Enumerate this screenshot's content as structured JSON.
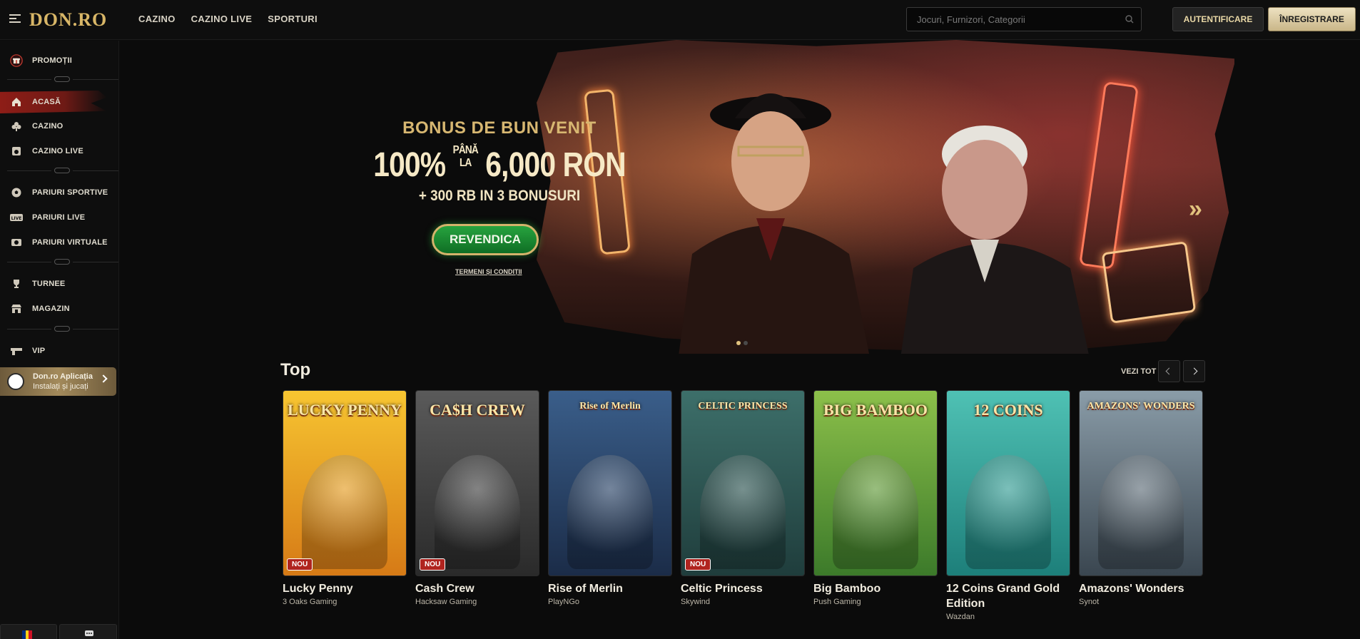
{
  "header": {
    "logo": "DON.RO",
    "nav": [
      "CAZINO",
      "CAZINO LIVE",
      "SPORTURI"
    ],
    "search_placeholder": "Jocuri, Furnizori, Categorii",
    "login_label": "AUTENTIFICARE",
    "register_label": "ÎNREGISTRARE"
  },
  "sidebar": {
    "items": [
      {
        "label": "PROMOȚII",
        "icon": "gift-icon"
      },
      {
        "label": "ACASĂ",
        "icon": "home-icon",
        "active": true
      },
      {
        "label": "CAZINO",
        "icon": "club-icon"
      },
      {
        "label": "CAZINO LIVE",
        "icon": "live-casino-icon"
      },
      {
        "label": "PARIURI SPORTIVE",
        "icon": "soccer-ball-icon"
      },
      {
        "label": "PARIURI LIVE",
        "icon": "live-badge-icon"
      },
      {
        "label": "PARIURI VIRTUALE",
        "icon": "virtual-sports-icon"
      },
      {
        "label": "TURNEE",
        "icon": "trophy-icon"
      },
      {
        "label": "MAGAZIN",
        "icon": "shop-icon"
      },
      {
        "label": "VIP",
        "icon": "vip-gun-icon"
      }
    ],
    "app_card": {
      "title": "Don.ro Aplicația",
      "subtitle": "Instalați și jucați"
    },
    "bottom": {
      "language_flag": "ro-flag-icon",
      "chat": "chat-icon"
    }
  },
  "banner": {
    "heading": "BONUS DE BUN VENIT",
    "offer_prefix": "100%",
    "offer_small_top": "PÂNĂ",
    "offer_small_bottom": "LA",
    "offer_amount": "6,000 RON",
    "offer_extra": "+ 300 RB IN 3 BONUSURI",
    "cta": "REVENDICA",
    "terms": "TERMENI ȘI CONDIȚII",
    "slide_count": 2,
    "active_slide": 1
  },
  "top_section": {
    "title": "Top",
    "see_all": "VEZI TOT",
    "games": [
      {
        "name": "Lucky Penny",
        "provider": "3 Oaks Gaming",
        "badge": "NOU",
        "art_title": "LUCKY PENNY",
        "colors": [
          "#f7c531",
          "#d67a16"
        ]
      },
      {
        "name": "Cash Crew",
        "provider": "Hacksaw Gaming",
        "badge": "NOU",
        "art_title": "CA$H CREW",
        "colors": [
          "#5a5a5a",
          "#2a2a2a"
        ]
      },
      {
        "name": "Rise of Merlin",
        "provider": "PlayNGo",
        "badge": "",
        "art_title": "Rise of Merlin",
        "colors": [
          "#3a5e8a",
          "#1b2c48"
        ]
      },
      {
        "name": "Celtic Princess",
        "provider": "Skywind",
        "badge": "NOU",
        "art_title": "CELTIC PRINCESS",
        "colors": [
          "#3d6f6a",
          "#1f3d3c"
        ]
      },
      {
        "name": "Big Bamboo",
        "provider": "Push Gaming",
        "badge": "",
        "art_title": "BIG BAMBOO",
        "colors": [
          "#8cc04a",
          "#3c7a2a"
        ]
      },
      {
        "name": "12 Coins Grand Gold Edition",
        "provider": "Wazdan",
        "badge": "",
        "art_title": "12 COINS",
        "colors": [
          "#4fc1b4",
          "#1d7f7a"
        ]
      },
      {
        "name": "Amazons' Wonders",
        "provider": "Synot",
        "badge": "",
        "art_title": "AMAZONS' WONDERS",
        "colors": [
          "#8a9ca8",
          "#3a4650"
        ]
      }
    ]
  }
}
